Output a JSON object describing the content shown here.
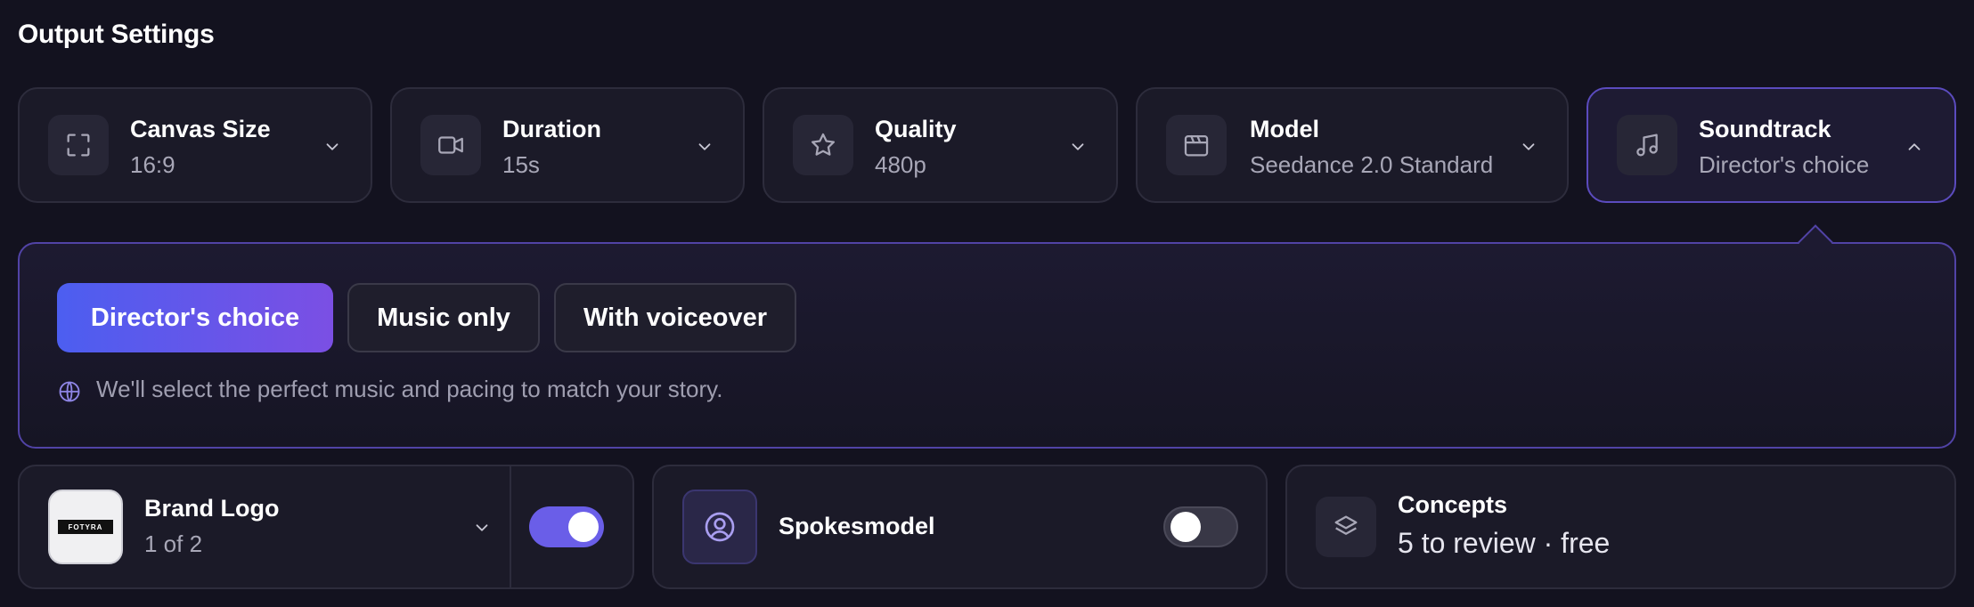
{
  "section_title": "Output Settings",
  "settings": [
    {
      "label": "Canvas Size",
      "value": "16:9",
      "icon": "expand-icon"
    },
    {
      "label": "Duration",
      "value": "15s",
      "icon": "video-icon"
    },
    {
      "label": "Quality",
      "value": "480p",
      "icon": "star-icon"
    },
    {
      "label": "Model",
      "value": "Seedance 2.0 Standard",
      "icon": "clapperboard-icon"
    },
    {
      "label": "Soundtrack",
      "value": "Director's choice",
      "icon": "music-icon",
      "expanded": true
    }
  ],
  "soundtrack_panel": {
    "options": [
      "Director's choice",
      "Music only",
      "With voiceover"
    ],
    "selected": "Director's choice",
    "hint": "We'll select the perfect music and pacing to match your story."
  },
  "brand_logo": {
    "label": "Brand Logo",
    "value": "1 of 2",
    "logo_text": "FOTYRA",
    "enabled": true
  },
  "spokesmodel": {
    "label": "Spokesmodel",
    "enabled": false
  },
  "concepts": {
    "label": "Concepts",
    "value": "5 to review · free"
  },
  "colors": {
    "accent": "#6a5ee8",
    "gradient_start": "#4c5ef0",
    "gradient_end": "#7b4fe4",
    "background": "#13121f"
  }
}
